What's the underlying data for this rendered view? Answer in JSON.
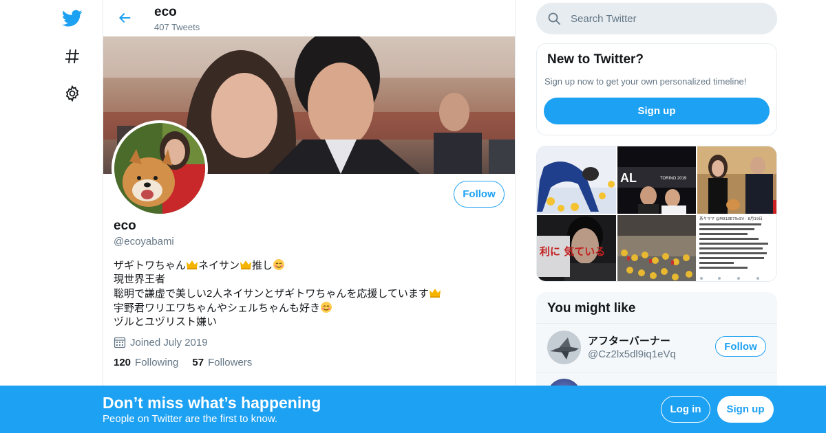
{
  "nav": {
    "items": [
      {
        "icon": "twitter-bird-icon"
      },
      {
        "icon": "hashtag-icon"
      },
      {
        "icon": "gear-icon"
      }
    ]
  },
  "header": {
    "name": "eco",
    "tweet_count": "407 Tweets"
  },
  "profile": {
    "name": "eco",
    "handle": "@ecoyabami",
    "follow_label": "Follow",
    "bio": [
      {
        "text": "ザギトワちゃん",
        "after_emoji_1": "crown",
        "text2": "ネイサン",
        "after_emoji_2": "crown",
        "text3": "推し",
        "after_emoji_3": "smiling-face"
      },
      {
        "text": "現世界王者"
      },
      {
        "text": "聡明で謙虚で美しい2人ネイサンとザギトワちゃんを応援しています",
        "emoji": "crown"
      },
      {
        "text": "宇野君ワリエワちゃんやシェルちゃんも好き",
        "emoji": "smiling-face"
      },
      {
        "text": "ヅルとユヅリスト嫌い"
      }
    ],
    "joined": "Joined July 2019",
    "following_count": "120",
    "following_label": "Following",
    "followers_count": "57",
    "followers_label": "Followers"
  },
  "search": {
    "placeholder": "Search Twitter"
  },
  "new_to_twitter": {
    "title": "New to Twitter?",
    "text": "Sign up now to get your own personalized timeline!",
    "signup_label": "Sign up"
  },
  "media_grid": {
    "items": [
      {
        "name": "photo-skater-fall"
      },
      {
        "name": "photo-grand-prix",
        "overlay_text": "AL",
        "small_text": "TORINO 2019"
      },
      {
        "name": "photo-handshake"
      },
      {
        "name": "photo-portrait",
        "overlay_text": "利に 気ている"
      },
      {
        "name": "photo-stands"
      },
      {
        "name": "photo-tweet-screenshot",
        "title": "茶々ママ @M918E79sSV · 8月19日"
      }
    ]
  },
  "you_might_like": {
    "title": "You might like",
    "users": [
      {
        "name": "アフターバーナー",
        "handle": "@Cz2lx5dl9iq1eVq",
        "follow_label": "Follow"
      }
    ]
  },
  "bottom_bar": {
    "headline": "Don’t miss what’s happening",
    "subtext": "People on Twitter are the first to know.",
    "login_label": "Log in",
    "signup_label": "Sign up"
  },
  "colors": {
    "accent": "#1da1f2",
    "text": "#14171a",
    "muted": "#657786",
    "border": "#e6ecf0"
  }
}
